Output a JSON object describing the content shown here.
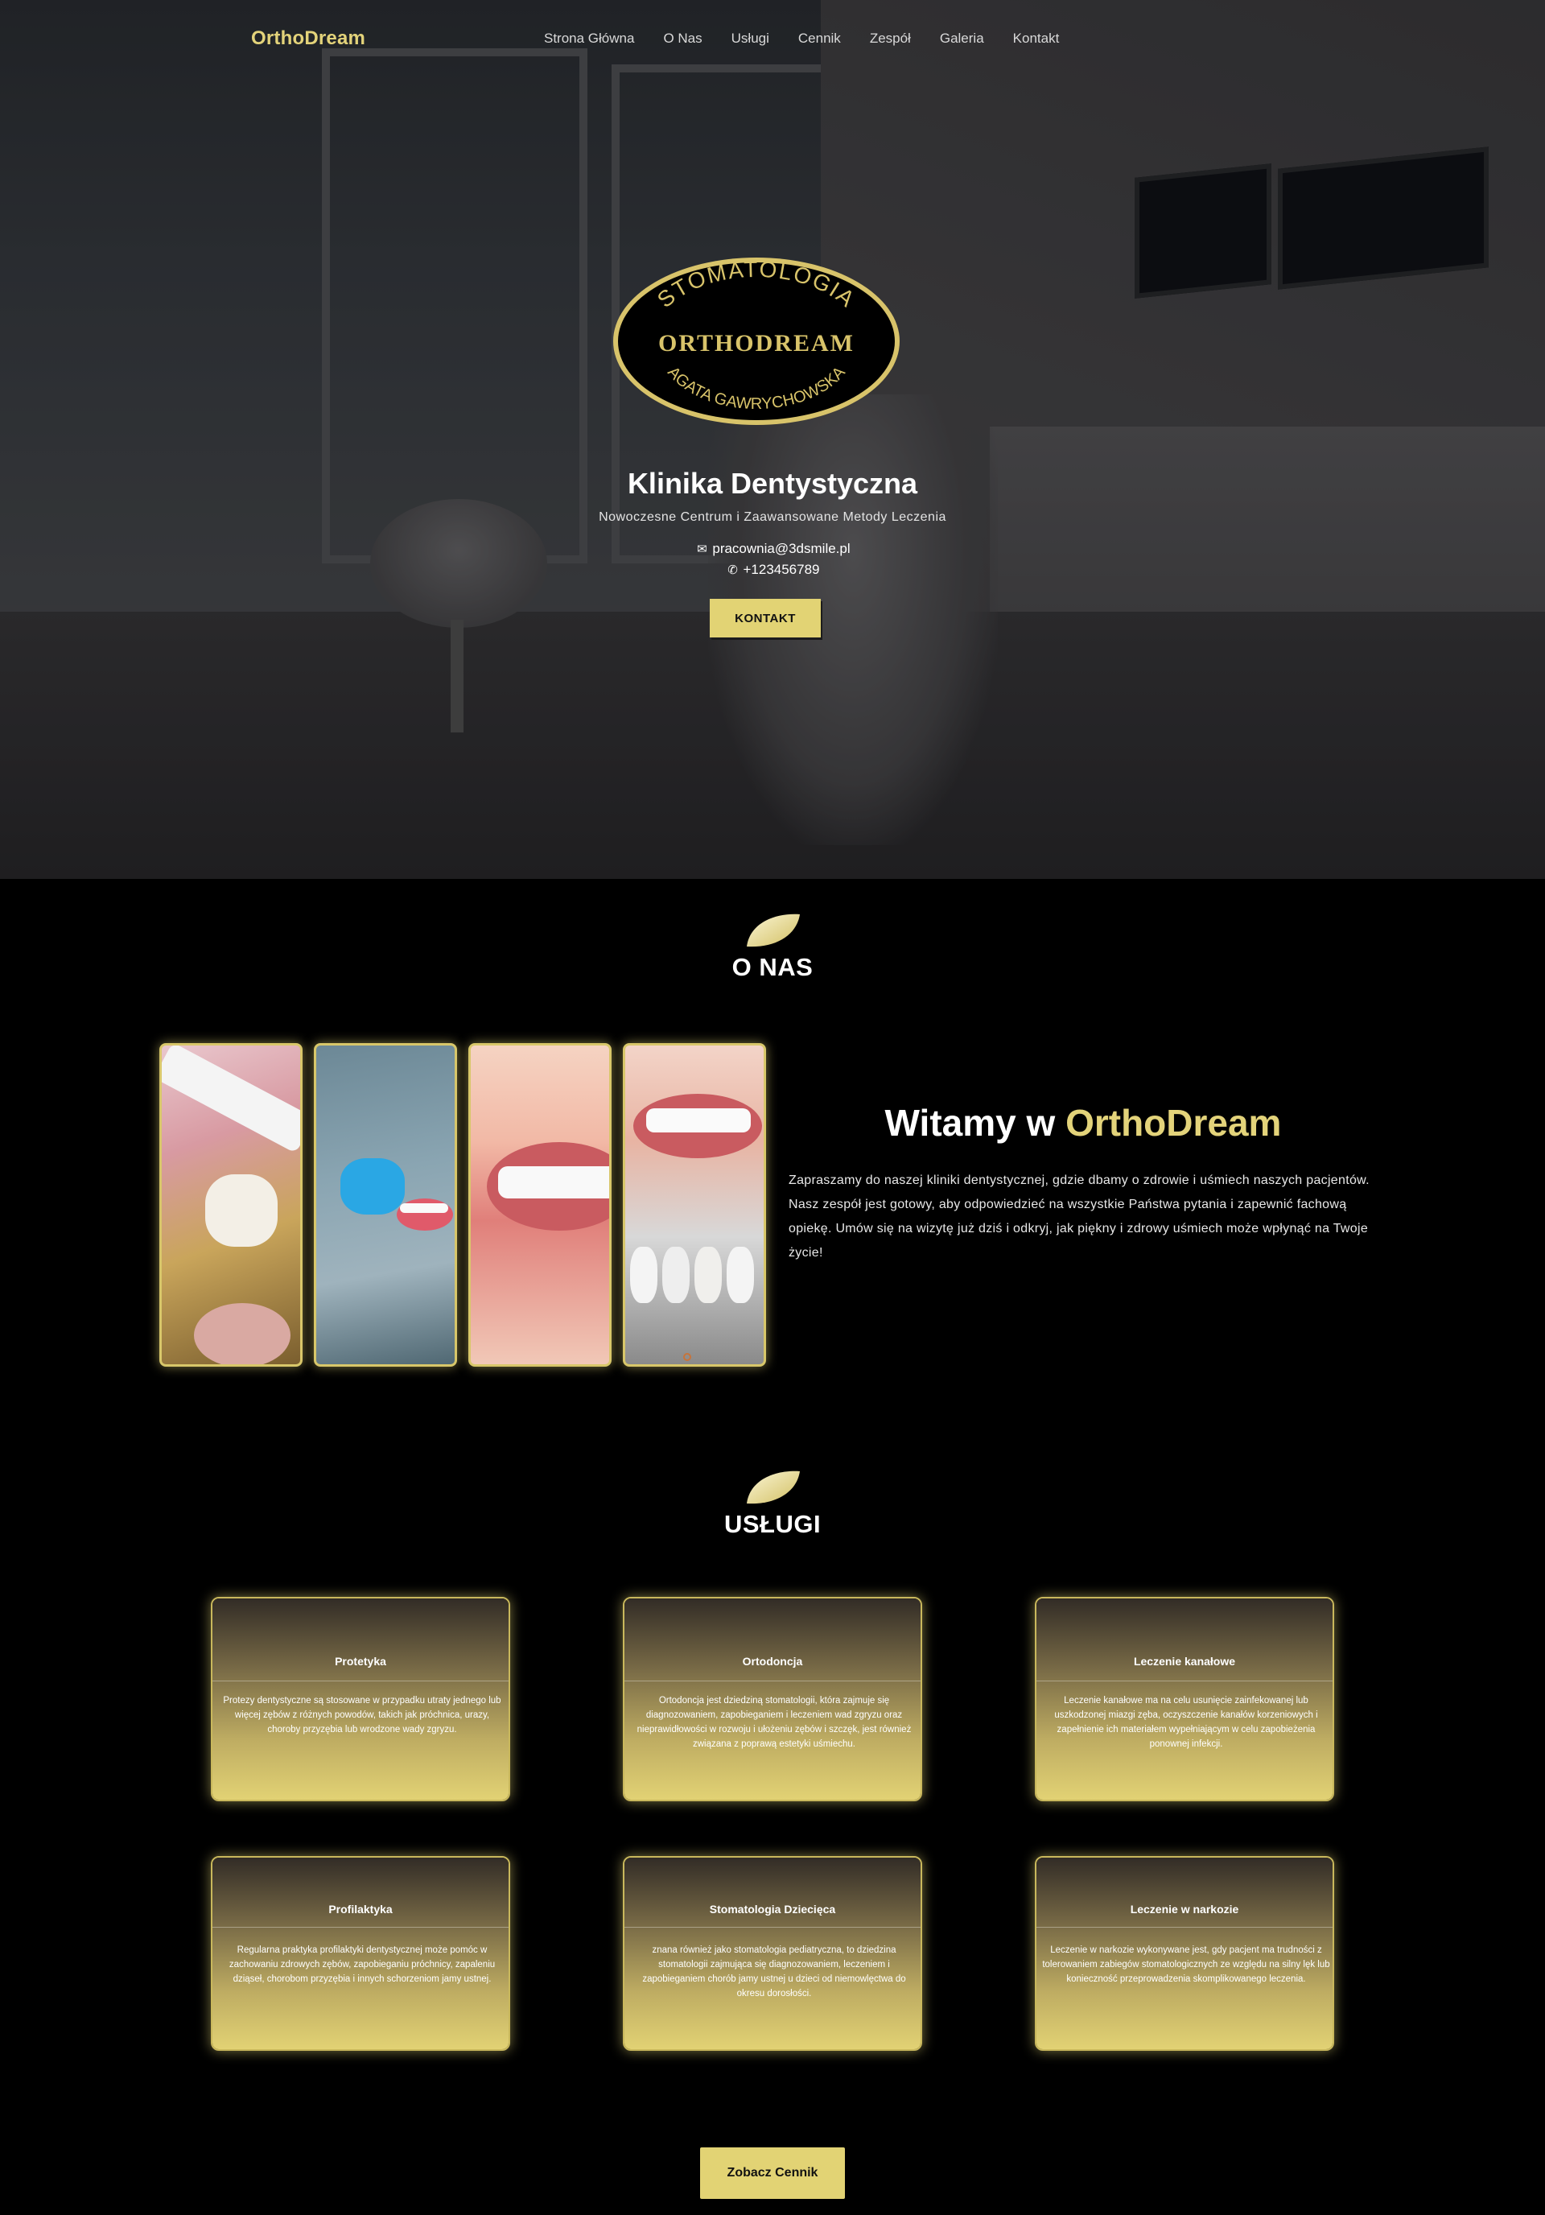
{
  "nav": {
    "brand": "OrthoDream",
    "items": [
      "Strona Główna",
      "O Nas",
      "Usługi",
      "Cennik",
      "Zespół",
      "Galeria",
      "Kontakt"
    ]
  },
  "hero": {
    "logo": {
      "top_text": "STOMATOLOGIA",
      "middle_text": "ORTHODREAM",
      "bottom_text": "AGATA GAWRYCHOWSKA"
    },
    "title": "Klinika Dentystyczna",
    "subtitle": "Nowoczesne Centrum i Zaawansowane Metody Leczenia",
    "email": "pracownia@3dsmile.pl",
    "phone": "+123456789",
    "button": "KONTAKT"
  },
  "about": {
    "heading": "O NAS",
    "welcome_prefix": "Witamy w",
    "welcome_accent": "OrthoDream",
    "text": "Zapraszamy do naszej kliniki dentystycznej, gdzie dbamy o zdrowie i uśmiech naszych pacjentów. Nasz zespół jest gotowy, aby odpowiedzieć na wszystkie Państwa pytania i zapewnić fachową opiekę. Umów się na wizytę już dziś i odkryj, jak piękny i zdrowy uśmiech może wpłynąć na Twoje życie!"
  },
  "services": {
    "heading": "USŁUGI",
    "items": [
      {
        "title": "Protetyka",
        "text": "Protezy dentystyczne są stosowane w przypadku utraty jednego lub więcej zębów z różnych powodów, takich jak próchnica, urazy, choroby przyzębia lub wrodzone wady zgryzu."
      },
      {
        "title": "Ortodoncja",
        "text": "Ortodoncja jest dziedziną stomatologii, która zajmuje się diagnozowaniem, zapobieganiem i leczeniem wad zgryzu oraz nieprawidłowości w rozwoju i ułożeniu zębów i szczęk, jest również związana z poprawą estetyki uśmiechu."
      },
      {
        "title": "Leczenie kanałowe",
        "text": "Leczenie kanałowe ma na celu usunięcie zainfekowanej lub uszkodzonej miazgi zęba, oczyszczenie kanałów korzeniowych i zapełnienie ich materiałem wypełniającym w celu zapobieżenia ponownej infekcji."
      },
      {
        "title": "Profilaktyka",
        "text": "Regularna praktyka profilaktyki dentystycznej może pomóc w zachowaniu zdrowych zębów, zapobieganiu próchnicy, zapaleniu dziąseł, chorobom przyzębia i innych schorzeniom jamy ustnej."
      },
      {
        "title": "Stomatologia Dziecięca",
        "text": "znana również jako stomatologia pediatryczna, to dziedzina stomatologii zajmująca się diagnozowaniem, leczeniem i zapobieganiem chorób jamy ustnej u dzieci od niemowlęctwa do okresu dorosłości."
      },
      {
        "title": "Leczenie w narkozie",
        "text": "Leczenie w narkozie wykonywane jest, gdy pacjent ma trudności z tolerowaniem zabiegów stomatologicznych ze względu na silny lęk lub konieczność przeprowadzenia skomplikowanego leczenia."
      }
    ],
    "cta": "Zobacz Cennik"
  },
  "colors": {
    "accent": "#e2d374",
    "background": "#000000"
  }
}
